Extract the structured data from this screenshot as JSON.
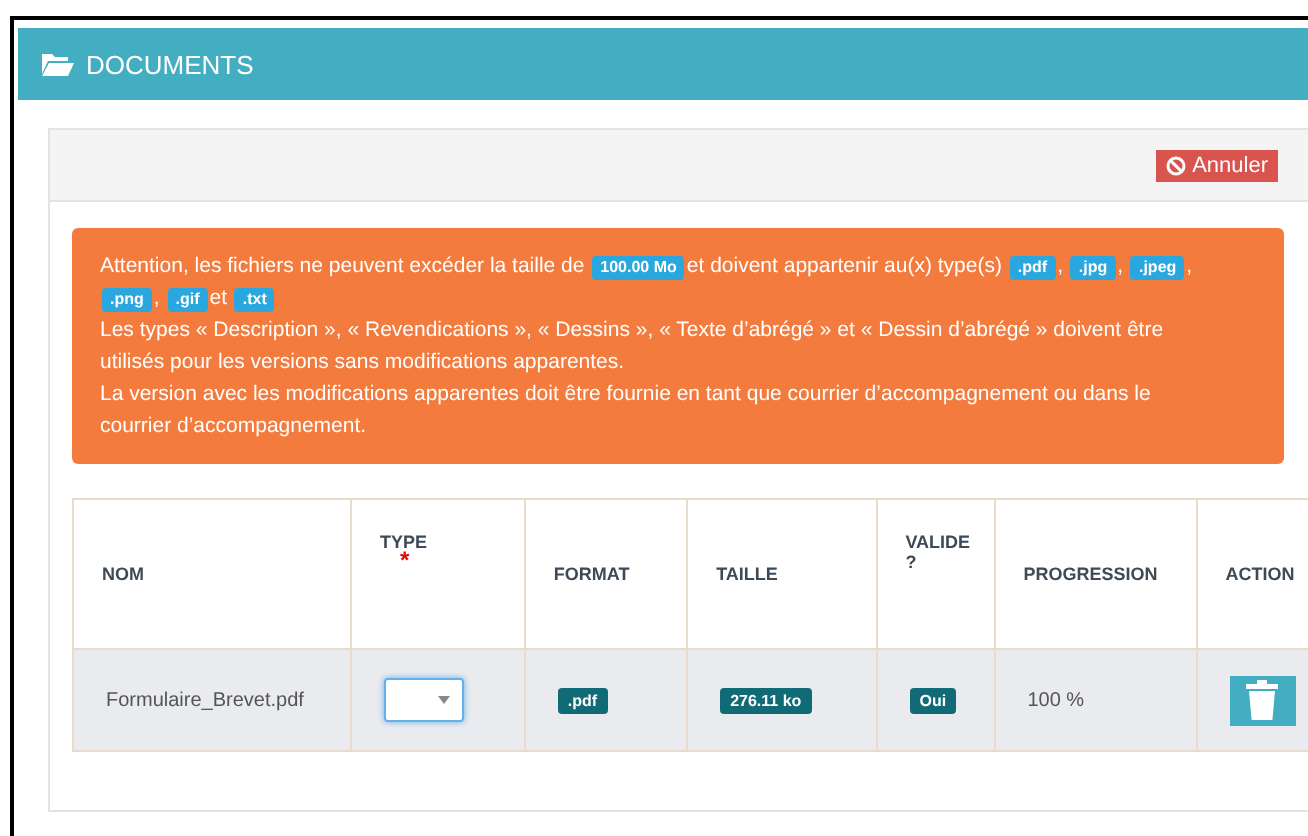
{
  "header": {
    "title": "DOCUMENTS"
  },
  "toolbar": {
    "cancel_button": "Annuler"
  },
  "notice": {
    "first_paragraph": [
      {
        "kind": "text",
        "text": "Attention, les fichiers ne peuvent excéder la taille de"
      },
      {
        "kind": "badge",
        "text": "100.00 Mo"
      },
      {
        "kind": "text",
        "text": "et doivent appartenir au(x) type(s)"
      },
      {
        "kind": "badge",
        "text": ".pdf"
      },
      {
        "kind": "text",
        "text": ","
      },
      {
        "kind": "badge",
        "text": ".jpg"
      },
      {
        "kind": "text",
        "text": ","
      },
      {
        "kind": "badge",
        "text": ".jpeg"
      },
      {
        "kind": "text",
        "text": ","
      },
      {
        "kind": "badge",
        "text": ".png"
      },
      {
        "kind": "text",
        "text": ","
      },
      {
        "kind": "badge",
        "text": ".gif"
      },
      {
        "kind": "text",
        "text": "et"
      },
      {
        "kind": "badge",
        "text": ".txt"
      }
    ],
    "paragraphs": [
      "Les types « Description », « Revendications », « Dessins », « Texte d’abrégé » et « Dessin d’abrégé » doivent être utilisés pour les versions sans modifications apparentes.",
      "La version avec les modifications apparentes doit être fournie en tant que courrier d’accompagnement ou dans le courrier d’accompagnement."
    ]
  },
  "table": {
    "columns": [
      {
        "label": "NOM",
        "required": false
      },
      {
        "label": "TYPE",
        "required": true,
        "marker": "*"
      },
      {
        "label": "FORMAT",
        "required": false
      },
      {
        "label": "TAILLE",
        "required": false
      },
      {
        "label": "VALIDE ?",
        "required": false
      },
      {
        "label": "PROGRESSION",
        "required": false
      },
      {
        "label": "ACTION",
        "required": false
      }
    ],
    "rows": [
      {
        "name": "Formulaire_Brevet.pdf",
        "type_focused": true,
        "format": ".pdf",
        "size": "276.11 ko",
        "valid": "Oui",
        "progress": "100 %"
      }
    ]
  }
}
